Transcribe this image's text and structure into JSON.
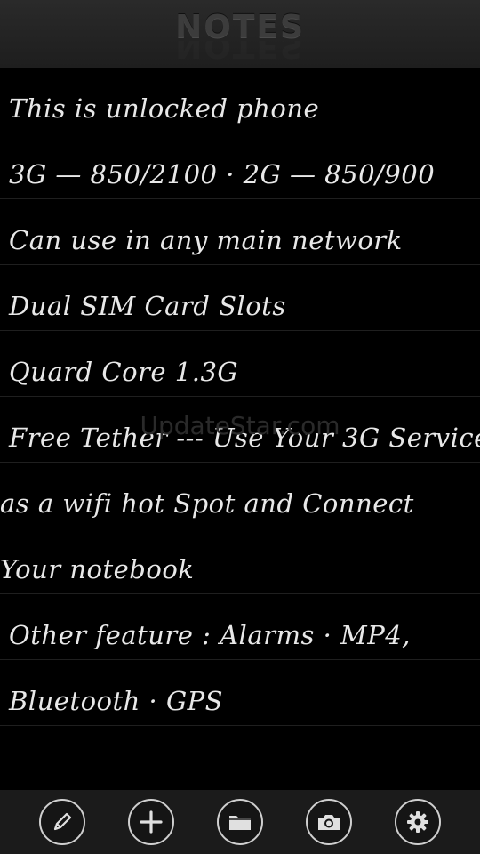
{
  "header": {
    "title": "NOTES"
  },
  "note": {
    "lines": [
      "This is unlocked phone",
      "3G — 850/2100 · 2G — 850/900",
      "Can use in any main network",
      "Dual SIM Card Slots",
      "Quard Core 1.3G",
      "Free Tether --- Use Your 3G Service",
      "as a wifi hot Spot and Connect",
      "Your notebook",
      "Other feature : Alarms · MP4,",
      "Bluetooth · GPS"
    ]
  },
  "watermark": "UpdateStar.com",
  "toolbar": {
    "buttons": [
      {
        "icon": "pencil-icon"
      },
      {
        "icon": "plus-icon"
      },
      {
        "icon": "folder-icon"
      },
      {
        "icon": "camera-icon"
      },
      {
        "icon": "gear-icon"
      }
    ]
  }
}
